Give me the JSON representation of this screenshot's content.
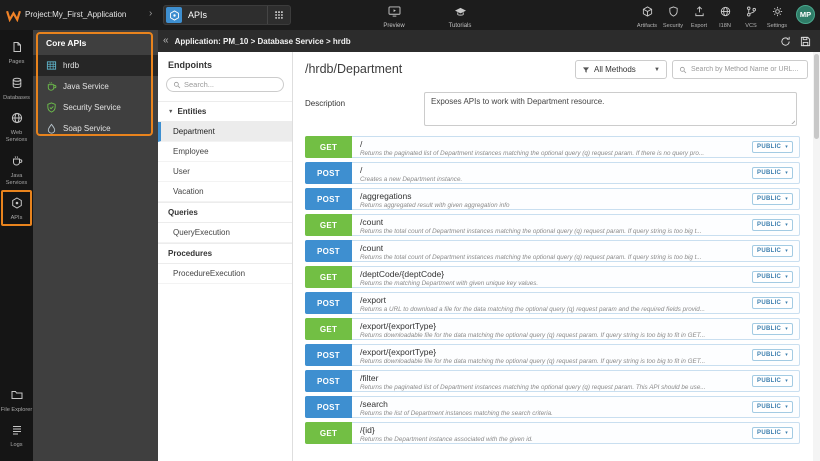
{
  "topbar": {
    "project_label": "Project:My_First_Application",
    "selector_label": "APIs",
    "preview_label": "Preview",
    "tutorials_label": "Tutorials",
    "tools": [
      {
        "label": "Artifacts",
        "icon": "artifacts"
      },
      {
        "label": "Security",
        "icon": "security"
      },
      {
        "label": "Export",
        "icon": "export"
      },
      {
        "label": "I18N",
        "icon": "i18n"
      },
      {
        "label": "VCS",
        "icon": "vcs"
      },
      {
        "label": "Settings",
        "icon": "settings"
      }
    ],
    "avatar_initials": "MP"
  },
  "left_nav": {
    "items": [
      {
        "label": "Pages",
        "icon": "pages"
      },
      {
        "label": "Databases",
        "icon": "databases"
      },
      {
        "label": "Web Services",
        "icon": "web"
      },
      {
        "label": "Java Services",
        "icon": "java"
      },
      {
        "label": "APIs",
        "icon": "api",
        "active": true,
        "annotated": true
      },
      {
        "label": "File Explorer",
        "icon": "folder",
        "group": "bottom"
      },
      {
        "label": "Logs",
        "icon": "logs",
        "group": "bottom"
      }
    ]
  },
  "core_apis": {
    "title": "Core APIs",
    "items": [
      {
        "label": "hrdb",
        "icon": "table",
        "icon_color": "#5fb3c9",
        "selected": true
      },
      {
        "label": "Java Service",
        "icon": "coffee",
        "icon_color": "#6dbe4b"
      },
      {
        "label": "Security Service",
        "icon": "shield",
        "icon_color": "#6dbe4b"
      },
      {
        "label": "Soap Service",
        "icon": "drop",
        "icon_color": "#b8c4cc"
      }
    ]
  },
  "breadcrumb": "Application: PM_10 > Database Service > hrdb",
  "endpoints": {
    "title": "Endpoints",
    "search_placeholder": "Search...",
    "sections": [
      {
        "label": "Entities",
        "caret": true,
        "selected": "Department",
        "items": [
          "Department",
          "Employee",
          "User",
          "Vacation"
        ]
      },
      {
        "label": "Queries",
        "items": [
          "QueryExecution"
        ]
      },
      {
        "label": "Procedures",
        "items": [
          "ProcedureExecution"
        ]
      }
    ]
  },
  "main": {
    "title": "/hrdb/Department",
    "methods_filter_label": "All Methods",
    "search_placeholder": "Search by Method Name or URL...",
    "description_label": "Description",
    "description_value": "Exposes APIs to work with Department resource.",
    "endpoints": [
      {
        "method": "GET",
        "path": "/",
        "desc": "Returns the paginated list of Department instances matching the optional query (q) request param. If there is no query pro...",
        "access": "PUBLIC"
      },
      {
        "method": "POST",
        "path": "/",
        "desc": "Creates a new Department instance.",
        "access": "PUBLIC"
      },
      {
        "method": "POST",
        "path": "/aggregations",
        "desc": "Returns aggregated result with given aggregation info",
        "access": "PUBLIC"
      },
      {
        "method": "GET",
        "path": "/count",
        "desc": "Returns the total count of Department instances matching the optional query (q) request param. If query string is too big t...",
        "access": "PUBLIC"
      },
      {
        "method": "POST",
        "path": "/count",
        "desc": "Returns the total count of Department instances matching the optional query (q) request param. If query string is too big t...",
        "access": "PUBLIC"
      },
      {
        "method": "GET",
        "path": "/deptCode/{deptCode}",
        "desc": "Returns the matching Department with given unique key values.",
        "access": "PUBLIC"
      },
      {
        "method": "POST",
        "path": "/export",
        "desc": "Returns a URL to download a file for the data matching the optional query (q) request param and the required fields provid...",
        "access": "PUBLIC"
      },
      {
        "method": "GET",
        "path": "/export/{exportType}",
        "desc": "Returns downloadable file for the data matching the optional query (q) request param. If query string is too big to fit in GET...",
        "access": "PUBLIC"
      },
      {
        "method": "POST",
        "path": "/export/{exportType}",
        "desc": "Returns downloadable file for the data matching the optional query (q) request param. If query string is too big to fit in GET...",
        "access": "PUBLIC"
      },
      {
        "method": "POST",
        "path": "/filter",
        "desc": "Returns the paginated list of Department instances matching the optional query (q) request param. This API should be use...",
        "access": "PUBLIC"
      },
      {
        "method": "POST",
        "path": "/search",
        "desc": "Returns the list of Department instances matching the search criteria.",
        "access": "PUBLIC"
      },
      {
        "method": "GET",
        "path": "/{id}",
        "desc": "Returns the Department instance associated with the given id.",
        "access": "PUBLIC"
      }
    ]
  },
  "colors": {
    "get": "#72bf44",
    "post": "#3e8fd0",
    "accent": "#3e8fd0",
    "annotation": "#e8831d",
    "pill": "#3d7fae"
  }
}
